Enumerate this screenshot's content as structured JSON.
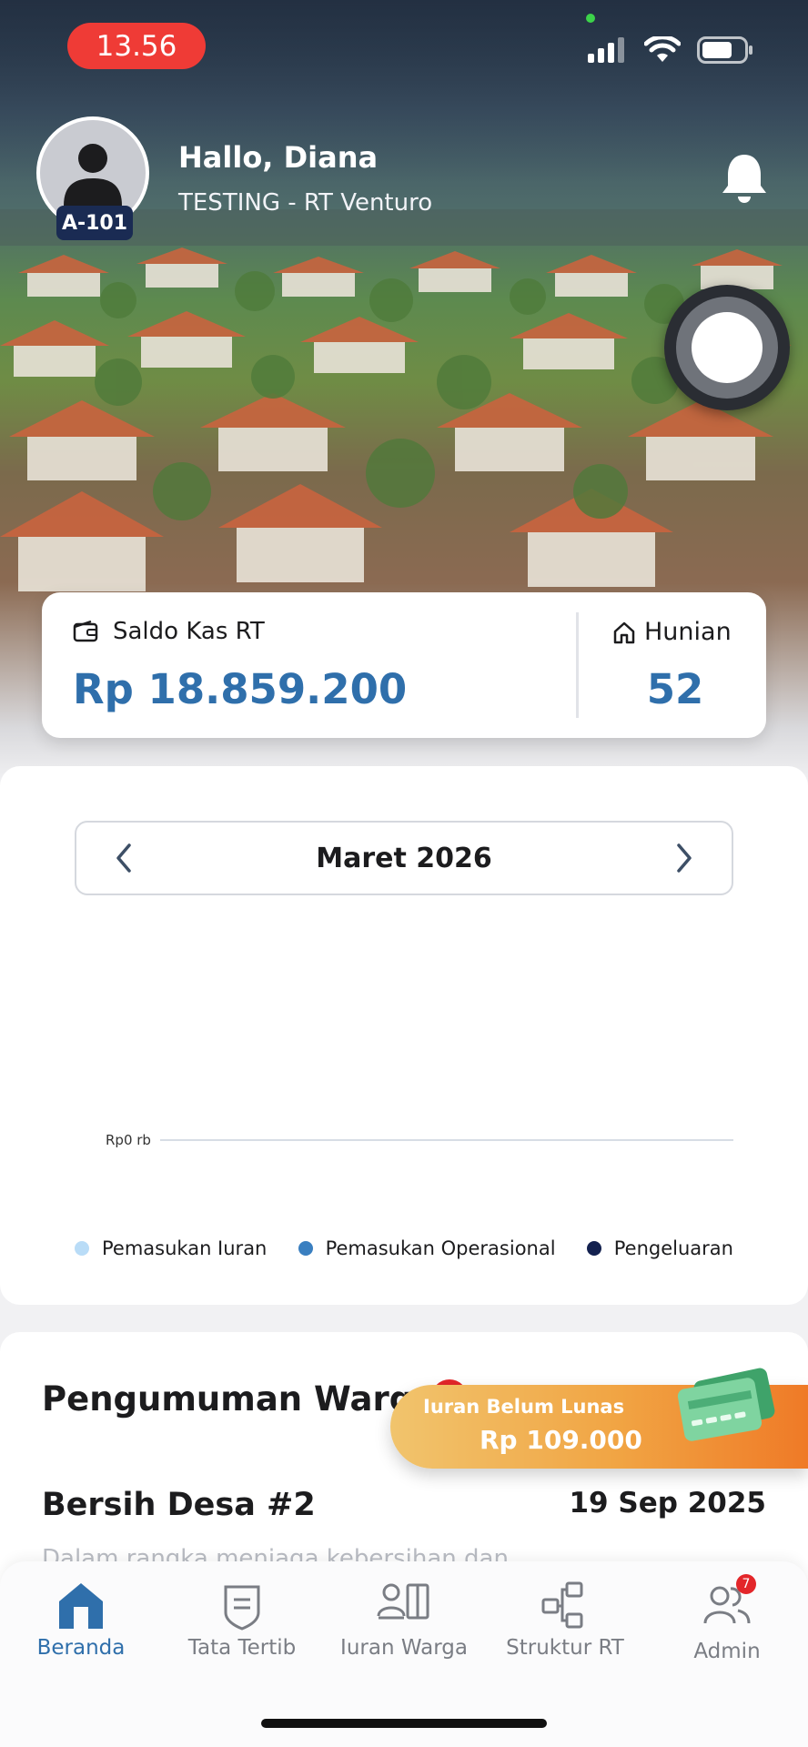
{
  "status_bar": {
    "time": "13.56"
  },
  "header": {
    "unit_code": "A-101",
    "greeting": "Hallo, Diana",
    "community": "TESTING - RT Venturo",
    "icons": {
      "notifications": "bell-icon",
      "assistant": "assistive-touch-icon"
    }
  },
  "summary": {
    "balance_label": "Saldo Kas RT",
    "balance_value": "Rp 18.859.200",
    "residence_label": "Hunian",
    "residence_value": "52"
  },
  "finance_chart": {
    "month": "Maret 2026",
    "legend": [
      "Pemasukan Iuran",
      "Pemasukan Operasional",
      "Pengeluaran"
    ],
    "colors": {
      "iuran": "#b9dcf7",
      "operasional": "#3a7fc0",
      "pengeluaran": "#13214f"
    }
  },
  "chart_data": {
    "type": "bar",
    "title": "",
    "categories": [],
    "series": [
      {
        "name": "Pemasukan Iuran",
        "values": []
      },
      {
        "name": "Pemasukan Operasional",
        "values": []
      },
      {
        "name": "Pengeluaran",
        "values": []
      }
    ],
    "y_ticks": [
      "Rp0 rb"
    ],
    "ylim": [
      0,
      0
    ]
  },
  "announcements": {
    "title": "Pengumuman Warga",
    "item_title": "Bersih Desa #2",
    "item_date": "19 Sep 2025",
    "item_preview": "Dalam rangka menjaga kebersihan dan"
  },
  "dues_banner": {
    "label": "Iuran Belum Lunas",
    "amount": "Rp 109.000"
  },
  "tabbar": {
    "tabs": [
      {
        "label": "Beranda",
        "icon": "home-icon",
        "active": true
      },
      {
        "label": "Tata Tertib",
        "icon": "rules-shield-icon"
      },
      {
        "label": "Iuran Warga",
        "icon": "resident-dues-icon"
      },
      {
        "label": "Struktur RT",
        "icon": "org-structure-icon"
      },
      {
        "label": "Admin",
        "icon": "admin-users-icon",
        "badge": "7"
      }
    ]
  }
}
